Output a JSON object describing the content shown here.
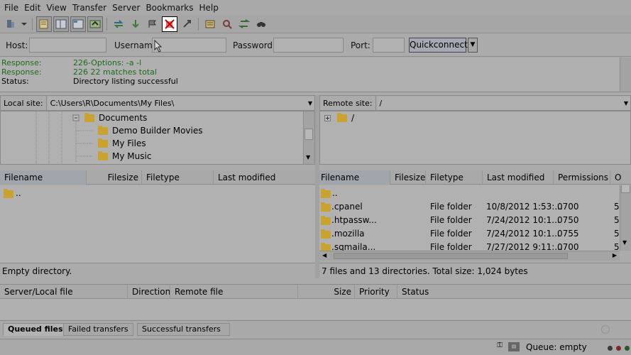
{
  "menu": [
    "File",
    "Edit",
    "View",
    "Transfer",
    "Server",
    "Bookmarks",
    "Help"
  ],
  "menu_underline": [
    "F",
    "E",
    "V",
    "T",
    "S",
    "B",
    "H"
  ],
  "toolbar": {
    "icons": [
      "site-manager-icon",
      "dropdown-arrow-icon",
      "toggle-log-icon",
      "toggle-local-tree-icon",
      "toggle-remote-tree-icon",
      "toggle-queue-icon",
      "refresh-icon",
      "process-queue-icon",
      "cancel-icon",
      "disconnect-icon",
      "reconnect-icon",
      "directory-listing-filters-icon",
      "compare-directories-icon",
      "sync-browsing-icon",
      "search-remote-icon"
    ]
  },
  "quickconnect": {
    "host_label": "Host:",
    "username_label": "Username:",
    "password_label": "Password:",
    "port_label": "Port:",
    "button_label": "Quickconnect",
    "host_value": "",
    "username_value": "",
    "password_value": "",
    "port_value": ""
  },
  "log": [
    {
      "kind": "Response:",
      "text": "226-Options: -a -l",
      "color": "green"
    },
    {
      "kind": "Response:",
      "text": "226 22 matches total",
      "color": "green"
    },
    {
      "kind": "Status:",
      "text": "Directory listing successful",
      "color": "black"
    }
  ],
  "local": {
    "site_label": "Local site:",
    "path": "C:\\Users\\R\\Documents\\My Files\\",
    "tree": [
      {
        "label": "Documents",
        "expanded": true
      },
      {
        "label": "Demo Builder Movies"
      },
      {
        "label": "My Files"
      },
      {
        "label": "My Music"
      }
    ],
    "columns": [
      "Filename",
      "Filesize",
      "Filetype",
      "Last modified"
    ],
    "rows": [
      {
        "name": "..",
        "size": "",
        "type": "",
        "modified": ""
      }
    ],
    "status": "Empty directory."
  },
  "remote": {
    "site_label": "Remote site:",
    "path": "/",
    "tree": [
      {
        "label": "/"
      }
    ],
    "columns": [
      "Filename",
      "Filesize",
      "Filetype",
      "Last modified",
      "Permissions",
      "O"
    ],
    "rows": [
      {
        "name": "..",
        "type": "",
        "modified": "",
        "perm": "",
        "owner": ""
      },
      {
        "name": ".cpanel",
        "type": "File folder",
        "modified": "10/8/2012 1:53:...",
        "perm": "0700",
        "owner": "5"
      },
      {
        "name": ".htpassw...",
        "type": "File folder",
        "modified": "7/24/2012 10:1...",
        "perm": "0750",
        "owner": "5"
      },
      {
        "name": ".mozilla",
        "type": "File folder",
        "modified": "7/24/2012 10:1...",
        "perm": "0755",
        "owner": "5"
      },
      {
        "name": ".sqmaila...",
        "type": "File folder",
        "modified": "7/27/2012 9:11:...",
        "perm": "0700",
        "owner": "5"
      }
    ],
    "status": "7 files and 13 directories. Total size: 1,024 bytes"
  },
  "queue": {
    "columns": [
      "Server/Local file",
      "Direction",
      "Remote file",
      "Size",
      "Priority",
      "Status"
    ],
    "tabs": [
      "Queued files",
      "Failed transfers",
      "Successful transfers"
    ],
    "status": "Queue: empty"
  },
  "colors": {
    "response_green": "#1d6b1d",
    "folder": "#c9a230",
    "cancel_red": "#cc0000"
  }
}
